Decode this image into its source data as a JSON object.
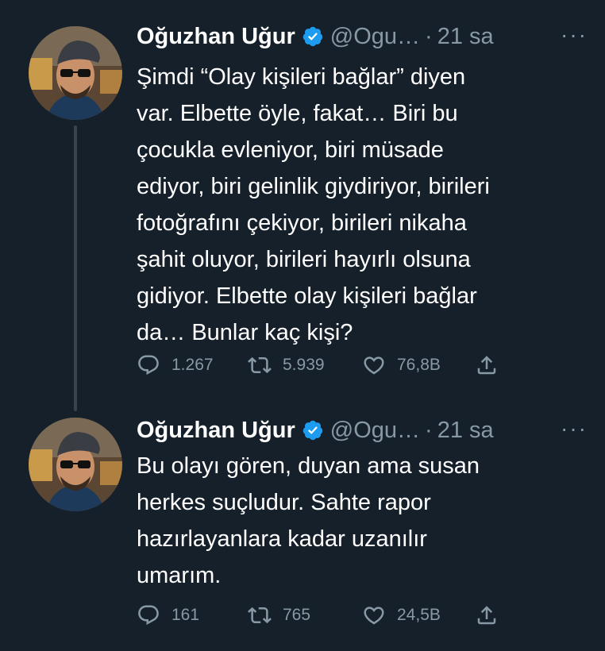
{
  "colors": {
    "background": "#15202b",
    "text_primary": "#ffffff",
    "text_secondary": "#8899a6",
    "verified_badge": "#1d9bf0",
    "thread_line": "#38444d"
  },
  "tweets": [
    {
      "author_name": "Oğuzhan Uğur",
      "handle": "@Ogu…",
      "separator": "·",
      "time": "21 sa",
      "more_label": "···",
      "text_lines": [
        "Şimdi “Olay kişileri bağlar” diyen",
        "var. Elbette öyle, fakat… Biri bu",
        "çocukla evleniyor, biri müsade",
        "ediyor, biri gelinlik giydiriyor, birileri",
        "fotoğrafını çekiyor, birileri nikaha",
        "şahit oluyor, birileri hayırlı olsuna",
        "gidiyor. Elbette olay kişileri bağlar",
        "da… Bunlar kaç kişi?"
      ],
      "replies": "1.267",
      "retweets": "5.939",
      "likes": "76,8B",
      "icons": [
        "reply-icon",
        "retweet-icon",
        "like-icon",
        "share-icon"
      ]
    },
    {
      "author_name": "Oğuzhan Uğur",
      "handle": "@Ogu…",
      "separator": "·",
      "time": "21 sa",
      "more_label": "···",
      "text_lines": [
        "Bu olayı gören, duyan ama susan",
        "herkes suçludur. Sahte rapor",
        "hazırlayanlara kadar uzanılır",
        "umarım."
      ],
      "replies": "161",
      "retweets": "765",
      "likes": "24,5B",
      "icons": [
        "reply-icon",
        "retweet-icon",
        "like-icon",
        "share-icon"
      ]
    }
  ]
}
